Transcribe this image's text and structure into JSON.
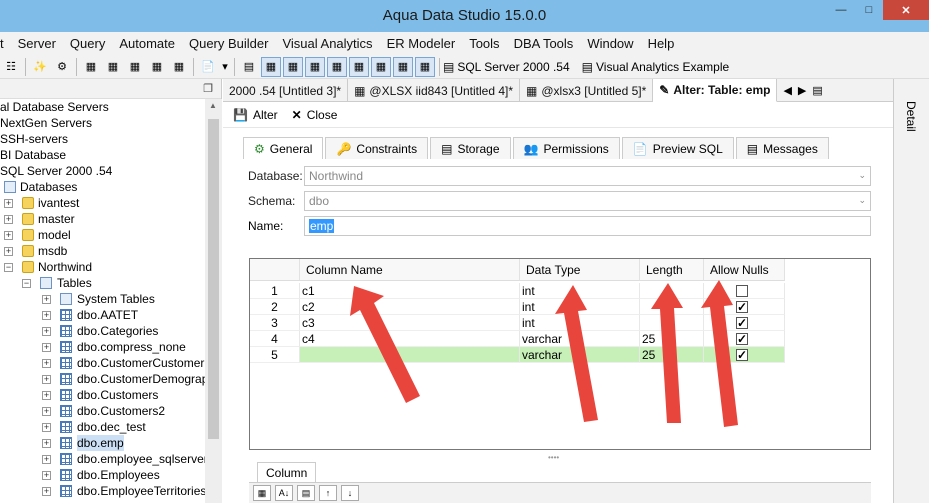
{
  "window": {
    "title": "Aqua Data Studio 15.0.0"
  },
  "menu": [
    "t",
    "Server",
    "Query",
    "Automate",
    "Query Builder",
    "Visual Analytics",
    "ER Modeler",
    "Tools",
    "DBA Tools",
    "Window",
    "Help"
  ],
  "toolbar": {
    "server_label": "SQL Server 2000 .54",
    "va_label": "Visual Analytics Example"
  },
  "tree": {
    "items": [
      {
        "label": "al Database Servers"
      },
      {
        "label": "NextGen Servers"
      },
      {
        "label": "SSH-servers"
      },
      {
        "label": "BI Database"
      },
      {
        "label": "SQL Server 2000 .54"
      },
      {
        "label": "Databases"
      },
      {
        "label": "ivantest"
      },
      {
        "label": "master"
      },
      {
        "label": "model"
      },
      {
        "label": "msdb"
      },
      {
        "label": "Northwind"
      },
      {
        "label": "Tables"
      },
      {
        "label": "System Tables"
      },
      {
        "label": "dbo.AATET"
      },
      {
        "label": "dbo.Categories"
      },
      {
        "label": "dbo.compress_none"
      },
      {
        "label": "dbo.CustomerCustomerDe"
      },
      {
        "label": "dbo.CustomerDemographi"
      },
      {
        "label": "dbo.Customers"
      },
      {
        "label": "dbo.Customers2"
      },
      {
        "label": "dbo.dec_test"
      },
      {
        "label": "dbo.emp"
      },
      {
        "label": "dbo.employee_sqlserver"
      },
      {
        "label": "dbo.Employees"
      },
      {
        "label": "dbo.EmployeeTerritories"
      }
    ]
  },
  "tabs": [
    {
      "label": "2000 .54 [Untitled 3]*"
    },
    {
      "label": "@XLSX iid843 [Untitled 4]*"
    },
    {
      "label": "@xlsx3 [Untitled 5]*"
    },
    {
      "label": "Alter: Table: emp"
    }
  ],
  "detail_label": "Detail",
  "editor": {
    "alter_label": "Alter",
    "close_label": "Close",
    "inner_tabs": [
      "General",
      "Constraints",
      "Storage",
      "Permissions",
      "Preview SQL",
      "Messages"
    ],
    "database_label": "Database:",
    "database_value": "Northwind",
    "schema_label": "Schema:",
    "schema_value": "dbo",
    "name_label": "Name:",
    "name_value": "emp"
  },
  "grid": {
    "headers": [
      "Column Name",
      "Data Type",
      "Length",
      "Allow Nulls"
    ],
    "rows": [
      {
        "num": "1",
        "name": "c1",
        "type": "int",
        "length": "",
        "nulls": false
      },
      {
        "num": "2",
        "name": "c2",
        "type": "int",
        "length": "",
        "nulls": true
      },
      {
        "num": "3",
        "name": "c3",
        "type": "int",
        "length": "",
        "nulls": true
      },
      {
        "num": "4",
        "name": "c4",
        "type": "varchar",
        "length": "25",
        "nulls": true
      },
      {
        "num": "5",
        "name": "",
        "type": "varchar",
        "length": "25",
        "nulls": true
      }
    ]
  },
  "column_tab_label": "Column",
  "colors": {
    "new_row": "#c6f0b8",
    "titlebar": "#7fbde8",
    "arrow": "#e8453c"
  }
}
